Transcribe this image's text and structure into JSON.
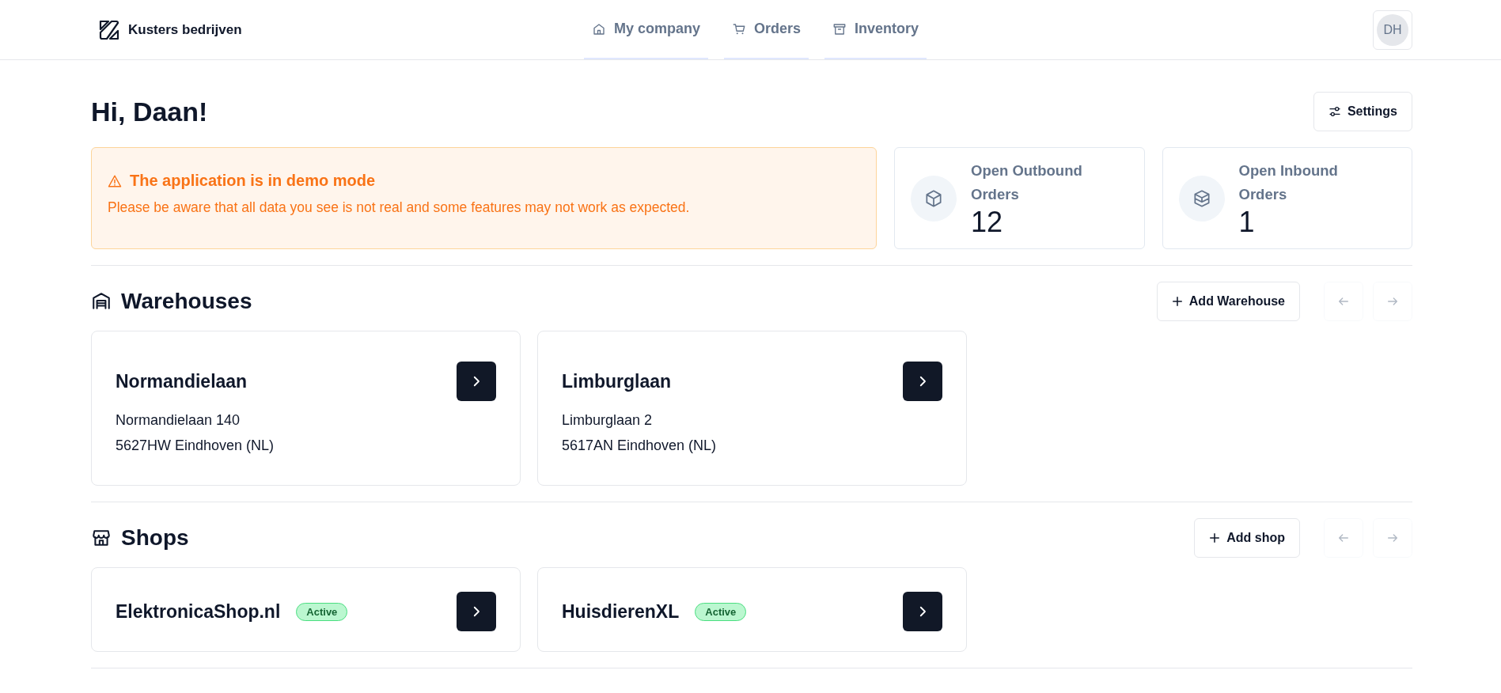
{
  "header": {
    "brand": "Kusters bedrijven",
    "nav": [
      {
        "label": "My company",
        "kind": "home"
      },
      {
        "label": "Orders",
        "kind": "cart"
      },
      {
        "label": "Inventory",
        "kind": "archive"
      }
    ],
    "avatar": "DH"
  },
  "greeting": "Hi, Daan!",
  "settings_button": "Settings",
  "banner": {
    "title": "The application is in demo mode",
    "message": "Please be aware that all data you see is not real and some features may not work as expected."
  },
  "stats": [
    {
      "label": "Open Outbound Orders",
      "value": "12",
      "kind": "box"
    },
    {
      "label": "Open Inbound Orders",
      "value": "1",
      "kind": "boxes"
    }
  ],
  "sections": [
    {
      "title": "Warehouses",
      "kind": "warehouse",
      "add_button": "Add Warehouse",
      "prev_disabled": true,
      "next_disabled": true,
      "cards": [
        {
          "name": "Normandielaan",
          "lines": [
            "Normandielaan 140",
            "5627HW Eindhoven (NL)"
          ]
        },
        {
          "name": "Limburglaan",
          "lines": [
            "Limburglaan 2",
            "5617AN Eindhoven (NL)"
          ]
        }
      ]
    },
    {
      "title": "Shops",
      "kind": "store",
      "add_button": "Add shop",
      "prev_disabled": true,
      "next_disabled": true,
      "cards": [
        {
          "name": "ElektronicaShop.nl",
          "status": "Active"
        },
        {
          "name": "HuisdierenXL",
          "status": "Active"
        }
      ]
    }
  ]
}
